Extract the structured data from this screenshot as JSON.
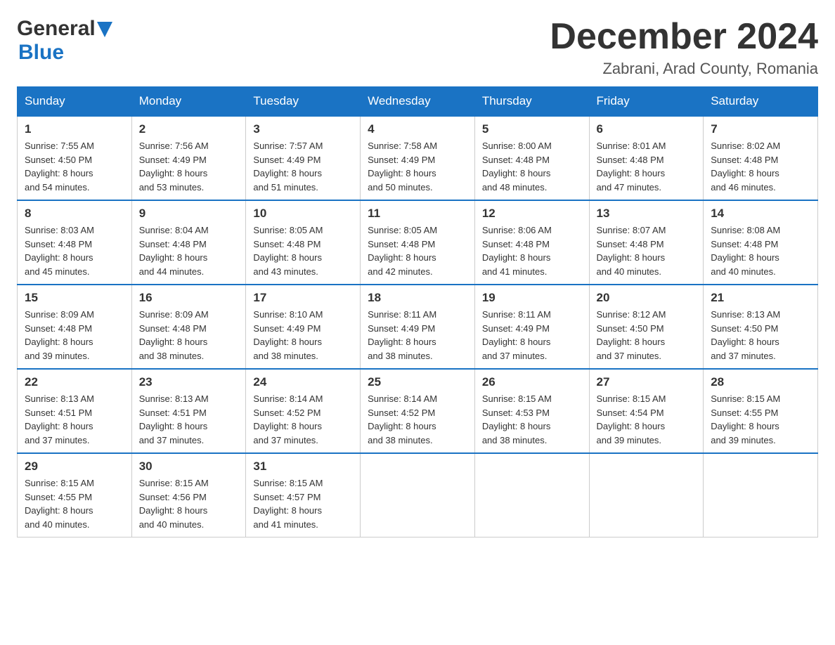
{
  "header": {
    "logo_general": "General",
    "logo_blue": "Blue",
    "month_title": "December 2024",
    "location": "Zabrani, Arad County, Romania"
  },
  "weekdays": [
    "Sunday",
    "Monday",
    "Tuesday",
    "Wednesday",
    "Thursday",
    "Friday",
    "Saturday"
  ],
  "weeks": [
    [
      {
        "day": "1",
        "sunrise": "7:55 AM",
        "sunset": "4:50 PM",
        "daylight": "8 hours and 54 minutes."
      },
      {
        "day": "2",
        "sunrise": "7:56 AM",
        "sunset": "4:49 PM",
        "daylight": "8 hours and 53 minutes."
      },
      {
        "day": "3",
        "sunrise": "7:57 AM",
        "sunset": "4:49 PM",
        "daylight": "8 hours and 51 minutes."
      },
      {
        "day": "4",
        "sunrise": "7:58 AM",
        "sunset": "4:49 PM",
        "daylight": "8 hours and 50 minutes."
      },
      {
        "day": "5",
        "sunrise": "8:00 AM",
        "sunset": "4:48 PM",
        "daylight": "8 hours and 48 minutes."
      },
      {
        "day": "6",
        "sunrise": "8:01 AM",
        "sunset": "4:48 PM",
        "daylight": "8 hours and 47 minutes."
      },
      {
        "day": "7",
        "sunrise": "8:02 AM",
        "sunset": "4:48 PM",
        "daylight": "8 hours and 46 minutes."
      }
    ],
    [
      {
        "day": "8",
        "sunrise": "8:03 AM",
        "sunset": "4:48 PM",
        "daylight": "8 hours and 45 minutes."
      },
      {
        "day": "9",
        "sunrise": "8:04 AM",
        "sunset": "4:48 PM",
        "daylight": "8 hours and 44 minutes."
      },
      {
        "day": "10",
        "sunrise": "8:05 AM",
        "sunset": "4:48 PM",
        "daylight": "8 hours and 43 minutes."
      },
      {
        "day": "11",
        "sunrise": "8:05 AM",
        "sunset": "4:48 PM",
        "daylight": "8 hours and 42 minutes."
      },
      {
        "day": "12",
        "sunrise": "8:06 AM",
        "sunset": "4:48 PM",
        "daylight": "8 hours and 41 minutes."
      },
      {
        "day": "13",
        "sunrise": "8:07 AM",
        "sunset": "4:48 PM",
        "daylight": "8 hours and 40 minutes."
      },
      {
        "day": "14",
        "sunrise": "8:08 AM",
        "sunset": "4:48 PM",
        "daylight": "8 hours and 40 minutes."
      }
    ],
    [
      {
        "day": "15",
        "sunrise": "8:09 AM",
        "sunset": "4:48 PM",
        "daylight": "8 hours and 39 minutes."
      },
      {
        "day": "16",
        "sunrise": "8:09 AM",
        "sunset": "4:48 PM",
        "daylight": "8 hours and 38 minutes."
      },
      {
        "day": "17",
        "sunrise": "8:10 AM",
        "sunset": "4:49 PM",
        "daylight": "8 hours and 38 minutes."
      },
      {
        "day": "18",
        "sunrise": "8:11 AM",
        "sunset": "4:49 PM",
        "daylight": "8 hours and 38 minutes."
      },
      {
        "day": "19",
        "sunrise": "8:11 AM",
        "sunset": "4:49 PM",
        "daylight": "8 hours and 37 minutes."
      },
      {
        "day": "20",
        "sunrise": "8:12 AM",
        "sunset": "4:50 PM",
        "daylight": "8 hours and 37 minutes."
      },
      {
        "day": "21",
        "sunrise": "8:13 AM",
        "sunset": "4:50 PM",
        "daylight": "8 hours and 37 minutes."
      }
    ],
    [
      {
        "day": "22",
        "sunrise": "8:13 AM",
        "sunset": "4:51 PM",
        "daylight": "8 hours and 37 minutes."
      },
      {
        "day": "23",
        "sunrise": "8:13 AM",
        "sunset": "4:51 PM",
        "daylight": "8 hours and 37 minutes."
      },
      {
        "day": "24",
        "sunrise": "8:14 AM",
        "sunset": "4:52 PM",
        "daylight": "8 hours and 37 minutes."
      },
      {
        "day": "25",
        "sunrise": "8:14 AM",
        "sunset": "4:52 PM",
        "daylight": "8 hours and 38 minutes."
      },
      {
        "day": "26",
        "sunrise": "8:15 AM",
        "sunset": "4:53 PM",
        "daylight": "8 hours and 38 minutes."
      },
      {
        "day": "27",
        "sunrise": "8:15 AM",
        "sunset": "4:54 PM",
        "daylight": "8 hours and 39 minutes."
      },
      {
        "day": "28",
        "sunrise": "8:15 AM",
        "sunset": "4:55 PM",
        "daylight": "8 hours and 39 minutes."
      }
    ],
    [
      {
        "day": "29",
        "sunrise": "8:15 AM",
        "sunset": "4:55 PM",
        "daylight": "8 hours and 40 minutes."
      },
      {
        "day": "30",
        "sunrise": "8:15 AM",
        "sunset": "4:56 PM",
        "daylight": "8 hours and 40 minutes."
      },
      {
        "day": "31",
        "sunrise": "8:15 AM",
        "sunset": "4:57 PM",
        "daylight": "8 hours and 41 minutes."
      },
      null,
      null,
      null,
      null
    ]
  ]
}
